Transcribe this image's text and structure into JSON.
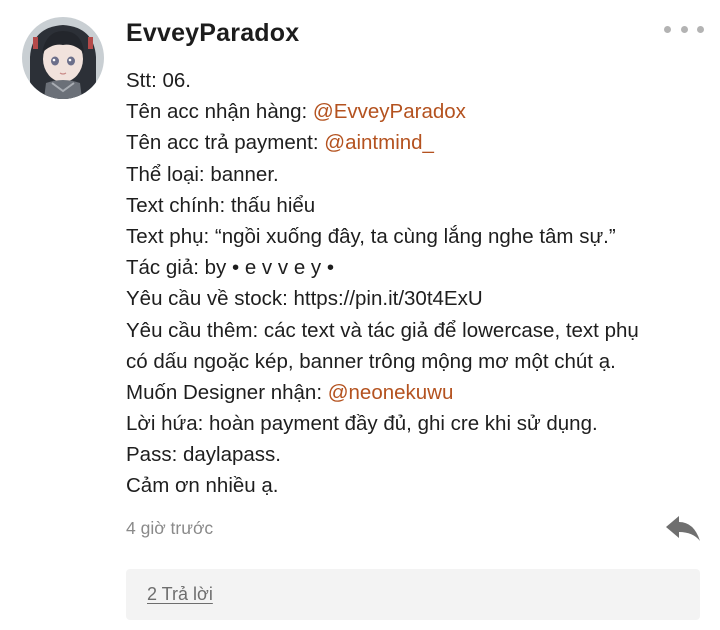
{
  "comment": {
    "username": "EvveyParadox",
    "lines": [
      [
        {
          "text": "Stt: 06."
        }
      ],
      [
        {
          "text": "Tên acc nhận hàng: "
        },
        {
          "text": "@EvveyParadox",
          "mention": true
        }
      ],
      [
        {
          "text": "Tên acc trả payment: "
        },
        {
          "text": "@aintmind_",
          "mention": true
        }
      ],
      [
        {
          "text": "Thể loại: banner."
        }
      ],
      [
        {
          "text": "Text chính: thấu hiểu"
        }
      ],
      [
        {
          "text": "Text phụ: “ngồi xuống đây, ta cùng lắng nghe tâm sự.”"
        }
      ],
      [
        {
          "text": "Tác giả: by • e v v e y •"
        }
      ],
      [
        {
          "text": "Yêu cầu về stock: https://pin.it/30t4ExU"
        }
      ],
      [
        {
          "text": "Yêu cầu thêm: các text và tác giả để lowercase, text phụ"
        }
      ],
      [
        {
          "text": "có dấu ngoặc kép, banner trông mộng mơ một chút ạ."
        }
      ],
      [
        {
          "text": "Muốn Designer nhận: "
        },
        {
          "text": "@neonekuwu",
          "mention": true
        }
      ],
      [
        {
          "text": "Lời hứa: hoàn payment đầy đủ, ghi cre khi sử dụng."
        }
      ],
      [
        {
          "text": "Pass: daylapass."
        }
      ],
      [
        {
          "text": "Cảm ơn nhiều ạ."
        }
      ]
    ],
    "timestamp": "4 giờ trước",
    "replies_label": "2 Trả lời"
  },
  "icons": {
    "avatar": "user-avatar",
    "more": "more-dots-icon",
    "reply": "reply-arrow-icon"
  },
  "colors": {
    "mention": "#b4521f",
    "text": "#1e1e1e",
    "muted": "#8a8a8a",
    "replies_bar": "#f3f3f3",
    "reply_icon": "#6f6f6f"
  }
}
